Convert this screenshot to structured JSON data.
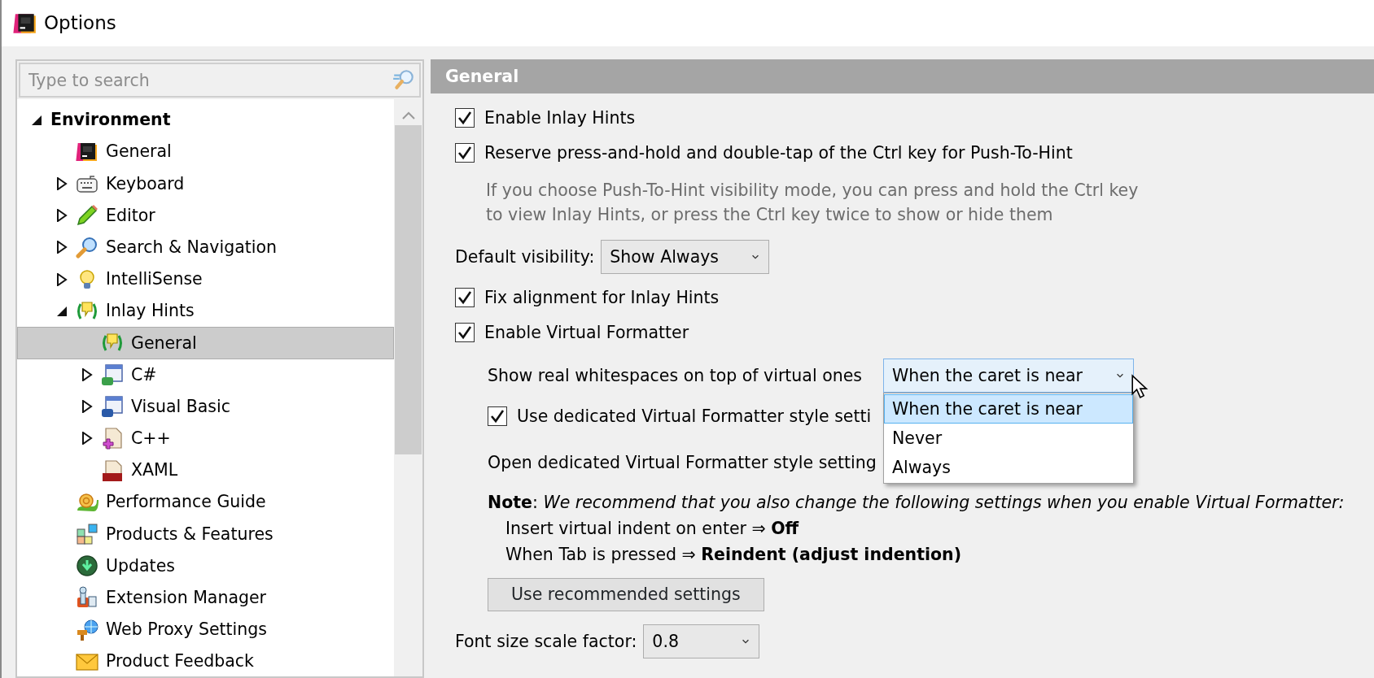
{
  "window": {
    "title": "Options"
  },
  "search": {
    "placeholder": "Type to search"
  },
  "tree": [
    {
      "label": "Environment",
      "expanded": true,
      "selected": false,
      "children": [
        {
          "label": "General",
          "selected": false
        },
        {
          "label": "Keyboard",
          "expanded": false,
          "selected": false
        },
        {
          "label": "Editor",
          "expanded": false,
          "selected": false
        },
        {
          "label": "Search & Navigation",
          "expanded": false,
          "selected": false
        },
        {
          "label": "IntelliSense",
          "expanded": false,
          "selected": false
        },
        {
          "label": "Inlay Hints",
          "expanded": true,
          "selected": false,
          "children": [
            {
              "label": "General",
              "selected": true
            },
            {
              "label": "C#",
              "expanded": false,
              "selected": false
            },
            {
              "label": "Visual Basic",
              "expanded": false,
              "selected": false
            },
            {
              "label": "C++",
              "expanded": false,
              "selected": false
            },
            {
              "label": "XAML",
              "selected": false
            }
          ]
        },
        {
          "label": "Performance Guide",
          "selected": false
        },
        {
          "label": "Products & Features",
          "selected": false
        },
        {
          "label": "Updates",
          "selected": false
        },
        {
          "label": "Extension Manager",
          "selected": false
        },
        {
          "label": "Web Proxy Settings",
          "selected": false
        },
        {
          "label": "Product Feedback",
          "selected": false
        }
      ]
    }
  ],
  "panel": {
    "title": "General",
    "settings": [
      {
        "kind": "checkbox",
        "label": "Enable Inlay Hints",
        "checked": true
      },
      {
        "kind": "checkbox",
        "label": "Reserve press-and-hold and double-tap of the Ctrl key for Push-To-Hint",
        "checked": true,
        "hint": [
          "If you choose Push-To-Hint visibility mode, you can press and hold the Ctrl key",
          "to view Inlay Hints, or press the Ctrl key twice to show or hide them"
        ]
      },
      {
        "kind": "select",
        "label": "Default visibility:",
        "value": "Show Always",
        "expanded": false
      },
      {
        "kind": "checkbox",
        "label": "Fix alignment for Inlay Hints",
        "checked": true
      },
      {
        "kind": "checkbox",
        "label": "Enable Virtual Formatter",
        "checked": true,
        "children": [
          {
            "kind": "select",
            "label": "Show real whitespaces on top of virtual ones",
            "value": "When the caret is near",
            "expanded": true,
            "options": [
              {
                "label": "When the caret is near",
                "selected": true
              },
              {
                "label": "Never",
                "selected": false
              },
              {
                "label": "Always",
                "selected": false
              }
            ]
          },
          {
            "kind": "checkbox",
            "label": "Use dedicated Virtual Formatter style setti",
            "checked": true
          },
          {
            "kind": "text",
            "label": "Open dedicated Virtual Formatter style setting"
          },
          {
            "kind": "note",
            "text": "**Note**: *We recommend that you also change the following settings when you enable Virtual Formatter:*",
            "lines": [
              "Insert virtual indent on enter ⇒ **Off**",
              "When Tab is pressed ⇒ **Reindent (adjust indention)**"
            ]
          },
          {
            "kind": "button",
            "label": "Use recommended settings"
          }
        ]
      },
      {
        "kind": "select",
        "label": "Font size scale factor:",
        "value": "0.8",
        "expanded": false
      }
    ]
  }
}
